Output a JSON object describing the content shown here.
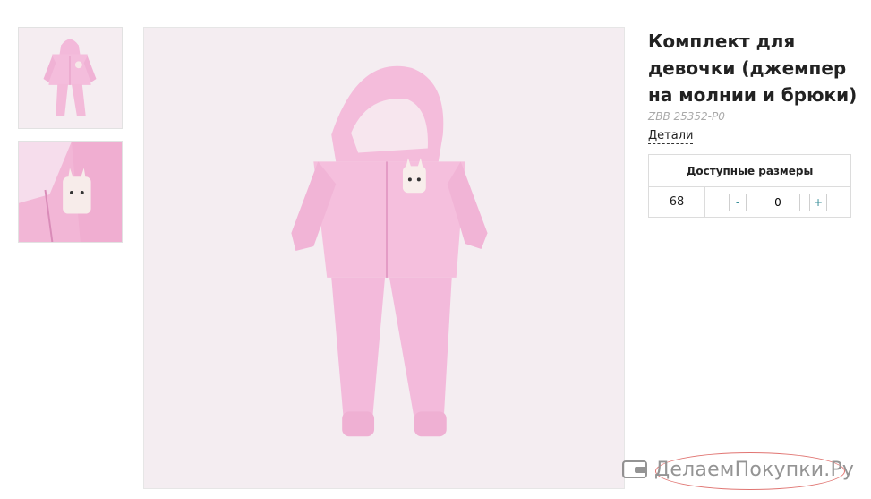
{
  "product": {
    "title": "Комплект для девочки (джемпер на молнии и брюки)",
    "sku": "ZBB 25352-P0",
    "details_link": "Детали"
  },
  "gallery": {
    "thumbnails": [
      "outfit-full-view",
      "outfit-closeup-bunny-patch"
    ],
    "main_image": "pink-hooded-zip-jumper-and-pants"
  },
  "sizes_table": {
    "header": "Доступные размеры",
    "rows": [
      {
        "size": "68",
        "minus": "-",
        "qty": "0",
        "plus": "+"
      }
    ]
  },
  "watermark": {
    "text": "ДелаемПокупки.Ру",
    "icon": "wallet-icon"
  },
  "colors": {
    "garment": "#f2b8d8",
    "accent": "#3a8f99",
    "watermark_oval": "#d9534f"
  }
}
